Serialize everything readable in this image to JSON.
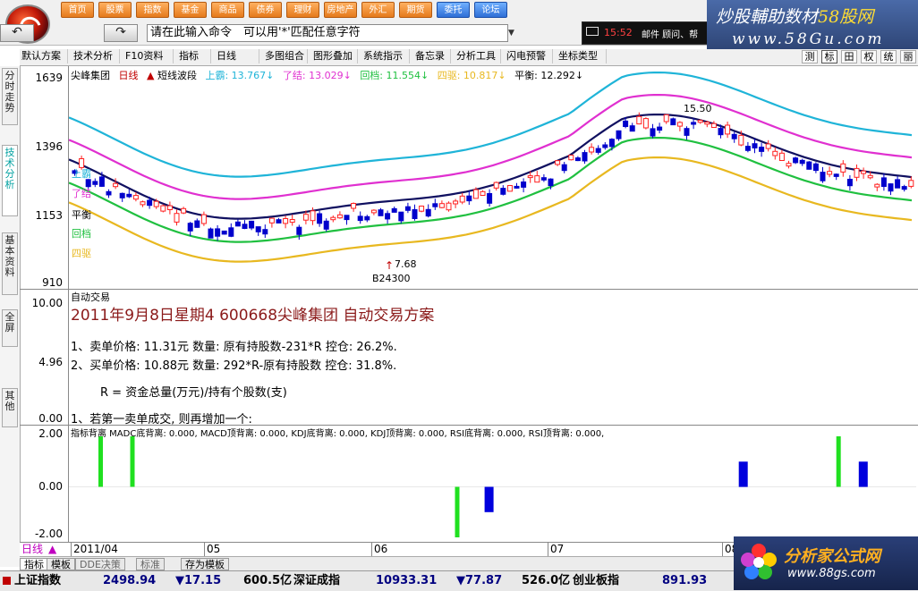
{
  "app": {
    "top_buttons": [
      "首页",
      "股票",
      "指数",
      "基金",
      "商品",
      "债券",
      "理财",
      "房地产",
      "外汇",
      "期货",
      "委托",
      "论坛"
    ],
    "command_placeholder": "请在此输入命令　可以用'*'匹配任意字符",
    "back_icon": "back-arrow-icon",
    "forward_icon": "forward-arrow-icon",
    "mail": {
      "time": "15:52",
      "label": "邮件 顾问、帮"
    },
    "brand_top_line1_a": "炒股輔助数材",
    "brand_top_line1_b": "58股网",
    "brand_top_line2": "www.58Gu.com"
  },
  "menu": {
    "items": [
      "默认方案",
      "技术分析",
      "F10资料",
      "指标",
      "日线",
      "多图组合",
      "图形叠加",
      "系统指示",
      "备忘录",
      "分析工具",
      "闪电预警",
      "坐标类型"
    ],
    "view_tabs": [
      "测",
      "标",
      "田",
      "权",
      "统",
      "丽"
    ]
  },
  "left_nav": [
    "分时走势",
    "技术分析",
    "基本资料",
    "全屏",
    "其他"
  ],
  "chart": {
    "stock_name": "尖峰集团",
    "period": "日线",
    "indicator": "短线波段",
    "legend": [
      {
        "label": "上霸: 13.767↓",
        "color": "#1fb4d8"
      },
      {
        "label": "了结: 13.029↓",
        "color": "#e030d0"
      },
      {
        "label": "回档: 11.554↓",
        "color": "#20c040"
      },
      {
        "label": "四驱: 10.817↓",
        "color": "#e8b820"
      },
      {
        "label": "平衡: 12.292↓",
        "color": "#000000"
      }
    ],
    "price_axis": [
      "1639",
      "1396",
      "1153",
      "910"
    ],
    "band_labels": [
      "上霸",
      "了结",
      "平衡",
      "回档",
      "四驱"
    ],
    "annotations": [
      "15.50",
      "7.68",
      "B24300"
    ],
    "colors": {
      "up": "#ff2020",
      "down": "#0000cc",
      "upper": "#1fb4d8",
      "exit": "#e030d0",
      "balance": "#101060",
      "pullback": "#20c040",
      "floor": "#e8b820"
    }
  },
  "plan": {
    "panel_title": "自动交易",
    "title": "2011年9月8日星期4 600668尖峰集团 自动交易方案",
    "axis": [
      "10.00",
      "4.96",
      "0.00"
    ],
    "lines": [
      "1、卖单价格: 11.31元   数量: 原有持股数-231*R    控仓: 26.2%.",
      "2、买单价格: 10.88元   数量: 292*R-原有持股数    控仓: 31.8%.",
      "R = 资金总量(万元)/持有个股数(支)",
      "1、若第一卖单成交, 则再增加一个:"
    ]
  },
  "divergence": {
    "title": "指标背离  MADC底背离: 0.000, MACD顶背离: 0.000, KDJ底背离: 0.000, KDJ顶背离: 0.000, RSI底背离: 0.000, RSI顶背离: 0.000,",
    "axis": [
      "2.00",
      "0.00",
      "-2.00"
    ]
  },
  "chart_data": {
    "type": "bar",
    "title": "指标背离",
    "x": [
      9,
      18,
      110,
      119,
      191,
      198,
      218,
      225
    ],
    "series": [
      {
        "name": "MADC底背离",
        "values": [
          2,
          2,
          -2,
          0,
          0,
          0,
          2,
          0
        ],
        "color": "#20e020"
      },
      {
        "name": "MACD顶背离",
        "values": [
          0,
          0,
          0,
          -1,
          1,
          0,
          0,
          1
        ],
        "color": "#0000dd"
      }
    ],
    "ylim": [
      -2,
      2
    ]
  },
  "date_axis": {
    "period_tag": "日线",
    "labels": [
      "2011/04",
      "05",
      "06",
      "07",
      "08"
    ]
  },
  "bottom_tabs": [
    "指标",
    "模板",
    "DDE决策",
    "标准",
    "存为模板"
  ],
  "status": {
    "sh_name": "上证指数",
    "sh_value": "2498.94",
    "sh_change": "▼17.15",
    "sh_amount": "600.5亿",
    "sz_name": "深证成指",
    "sz_value": "10933.31",
    "sz_change": "▼77.87",
    "sz_amount": "526.0亿",
    "cy_name": "创业板指",
    "cy_value": "891.93"
  },
  "brand_bottom": {
    "line1": "分析家公式网",
    "line2": "www.88gs.com"
  }
}
